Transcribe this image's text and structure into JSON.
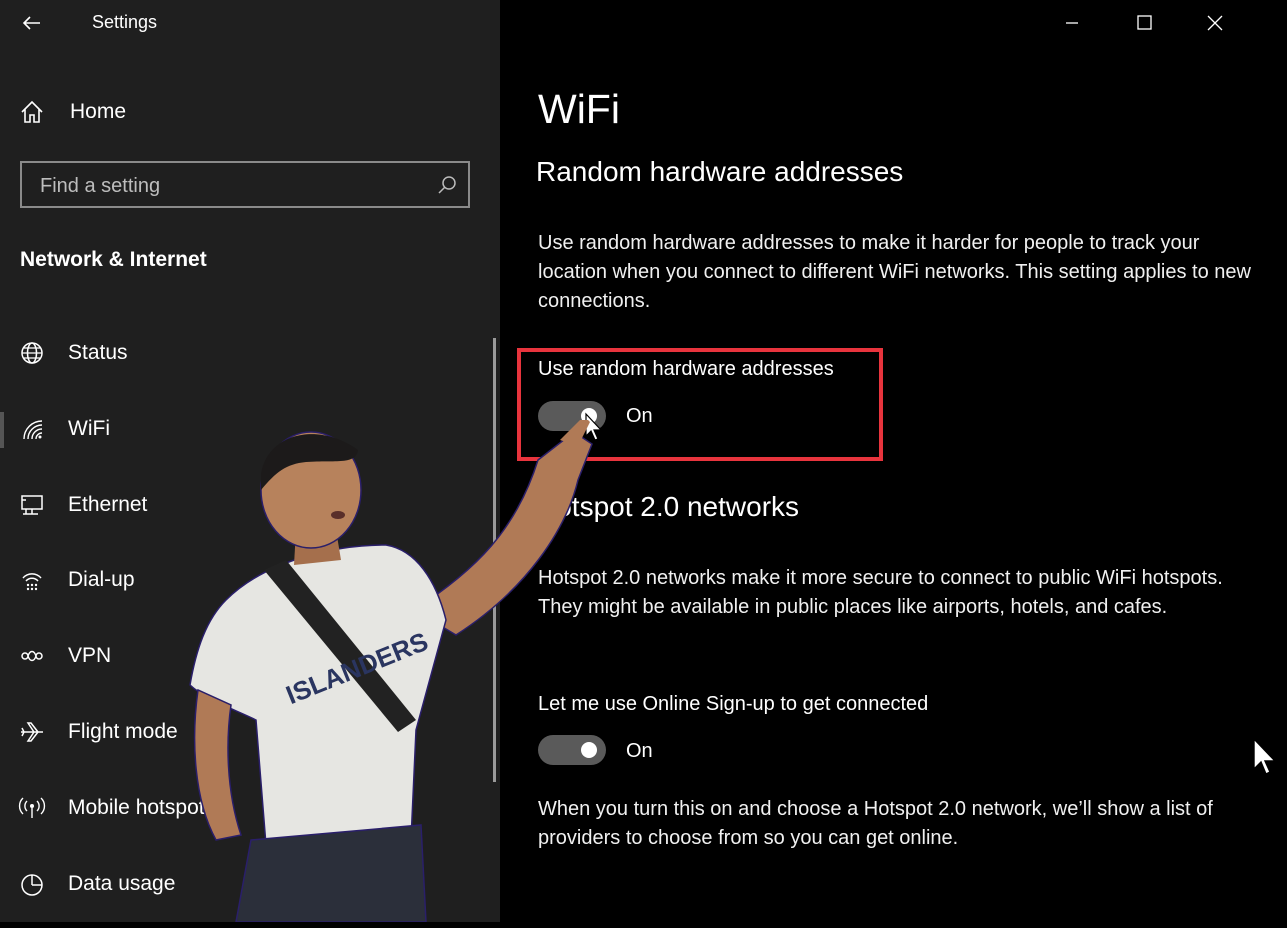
{
  "window": {
    "title": "Settings",
    "controls": [
      "minimize-icon",
      "maximize-icon",
      "close-icon"
    ]
  },
  "sidebar": {
    "home_label": "Home",
    "search": {
      "placeholder": "Find a setting"
    },
    "section_label": "Network & Internet",
    "items": [
      {
        "label": "Status",
        "icon": "globe-icon"
      },
      {
        "label": "WiFi",
        "icon": "wifi-icon",
        "selected": true
      },
      {
        "label": "Ethernet",
        "icon": "ethernet-icon"
      },
      {
        "label": "Dial-up",
        "icon": "dialup-icon"
      },
      {
        "label": "VPN",
        "icon": "vpn-icon"
      },
      {
        "label": "Flight mode",
        "icon": "airplane-icon"
      },
      {
        "label": "Mobile hotspot",
        "icon": "hotspot-icon"
      },
      {
        "label": "Data usage",
        "icon": "pie-chart-icon"
      }
    ]
  },
  "main": {
    "page_title": "WiFi",
    "random_hw": {
      "title": "Random hardware addresses",
      "description": "Use random hardware addresses to make it harder for people to track your location when you connect to different WiFi networks. This setting applies to new connections.",
      "toggle_label": "Use random hardware addresses",
      "toggle_state": "On",
      "toggle_on": true
    },
    "hotspot": {
      "title": "Hotspot 2.0 networks",
      "description": "Hotspot 2.0 networks make it more secure to connect to public WiFi hotspots. They might be available in public places like airports, hotels, and cafes.",
      "toggle_label": "Let me use Online Sign-up to get connected",
      "toggle_state": "On",
      "toggle_on": true,
      "footer": "When you turn this on and choose a Hotspot 2.0 network, we’ll show a list of providers to choose from so you can get online."
    }
  },
  "overlay": {
    "shirt_text": "ISLANDERS"
  },
  "colors": {
    "sidebar_bg": "#1f1f1f",
    "content_bg": "#000000",
    "highlight": "#e8343d",
    "toggle_track": "#5a5a5a"
  }
}
